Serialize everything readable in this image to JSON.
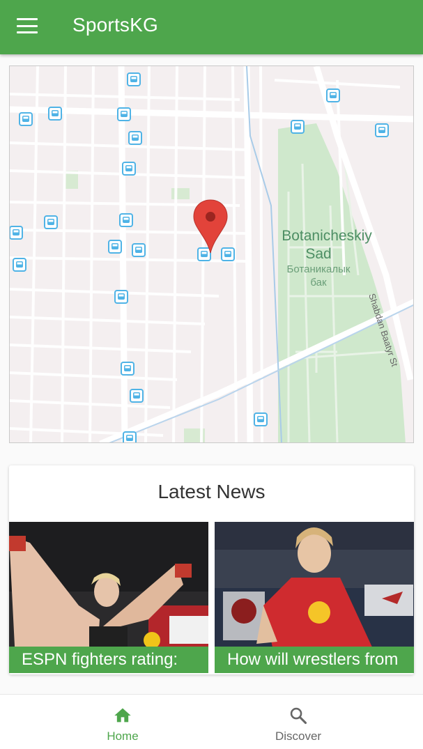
{
  "app_bar": {
    "title": "SportsKG",
    "menu_icon": "hamburger-menu-icon",
    "color": "#4ea64c"
  },
  "map": {
    "park_label_en_1": "Botanicheskiy",
    "park_label_en_2": "Sad",
    "park_label_ru_1": "Ботаникалык",
    "park_label_ru_2": "бак",
    "street_label": "Shabdan Baatyr St",
    "marker_icon": "location-pin-icon",
    "stop_icon": "bus-stop-icon",
    "park_color": "#cfe8cc",
    "stop_color": "#4fb3e6",
    "marker_color": "#e2433a"
  },
  "news": {
    "heading": "Latest News",
    "items": [
      {
        "caption": "ESPN fighters rating:"
      },
      {
        "caption": "How will wrestlers from"
      }
    ]
  },
  "bottom_nav": {
    "items": [
      {
        "label": "Home",
        "icon": "home-icon",
        "active": true
      },
      {
        "label": "Discover",
        "icon": "search-icon",
        "active": false
      }
    ],
    "active_color": "#4ea64c"
  }
}
